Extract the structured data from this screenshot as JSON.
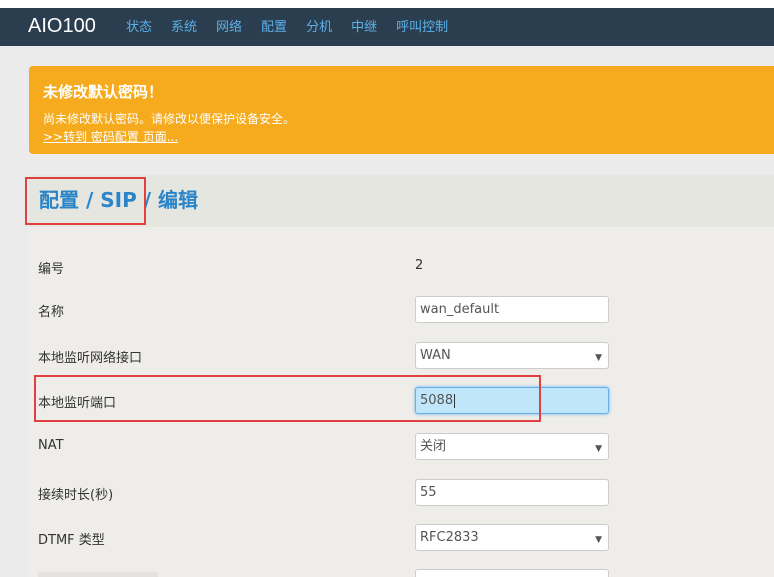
{
  "header": {
    "brand": "AIO100",
    "nav": [
      "状态",
      "系统",
      "网络",
      "配置",
      "分机",
      "中继",
      "呼叫控制"
    ]
  },
  "alert": {
    "title": "未修改默认密码！",
    "text": "尚未修改默认密码。请修改以便保护设备安全。",
    "link": ">>转到 密码配置 页面..."
  },
  "breadcrumb": "配置 / SIP / 编辑",
  "form": {
    "id_label": "编号",
    "id_value": "2",
    "name_label": "名称",
    "name_value": "wan_default",
    "iface_label": "本地监听网络接口",
    "iface_value": "WAN",
    "port_label": "本地监听端口",
    "port_value": "5088",
    "nat_label": "NAT",
    "nat_value": "关闭",
    "keepalive_label": "接续时长(秒)",
    "keepalive_value": "55",
    "dtmf_label": "DTMF 类型",
    "dtmf_value": "RFC2833"
  },
  "icons": {
    "select_arrow": "chevron-down-icon"
  },
  "colors": {
    "navbar": "#2b3e50",
    "nav_link": "#5bb0e8",
    "alert": "#f5ab1d",
    "breadcrumb": "#2a85c8",
    "highlight": "#e0403f"
  }
}
